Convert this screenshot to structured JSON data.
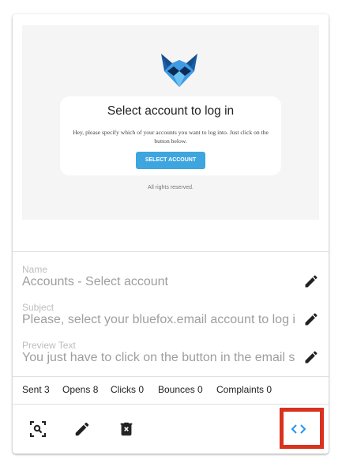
{
  "email_preview": {
    "title": "Select account to log in",
    "body": "Hey, please specify which of your accounts you want to log into. Just click on the button below.",
    "button_label": "SELECT ACCOUNT",
    "footer": "All rights reserved.",
    "logo_icon": "bluefox-logo",
    "button_color": "#3ea5df"
  },
  "fields": {
    "name": {
      "label": "Name",
      "value": "Accounts - Select account"
    },
    "subject": {
      "label": "Subject",
      "value": "Please, select your bluefox.email account to log in"
    },
    "preview_text": {
      "label": "Preview Text",
      "value": "You just have to click on the button in the email so we can log you in"
    }
  },
  "stats": {
    "sent": "Sent 3",
    "opens": "Opens 8",
    "clicks": "Clicks 0",
    "bounces": "Bounces 0",
    "complaints": "Complaints 0"
  },
  "actions": {
    "preview_icon": "zoom-icon",
    "edit_icon": "pencil-icon",
    "delete_icon": "trash-icon",
    "code_icon": "code-icon",
    "code_color": "#2196f3",
    "highlight_color": "#d9321f"
  }
}
